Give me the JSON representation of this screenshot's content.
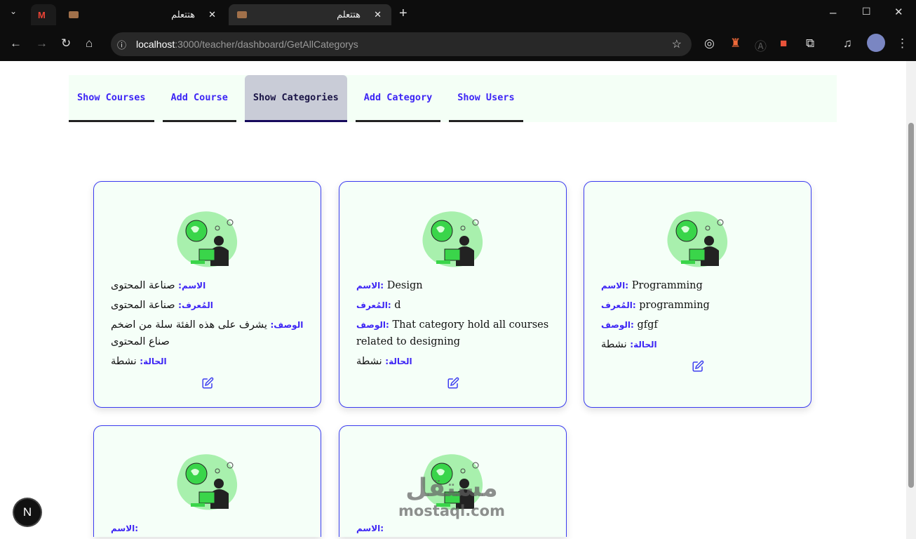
{
  "browser": {
    "tabs": [
      {
        "title": "هتتعلم"
      },
      {
        "title": "هتتعلم"
      }
    ],
    "url_host": "localhost",
    "url_path": ":3000/teacher/dashboard/GetAllCategorys"
  },
  "nav": {
    "tabs": [
      {
        "label": "Show Courses",
        "active": false
      },
      {
        "label": "Add Course",
        "active": false
      },
      {
        "label": "Show Categories",
        "active": true
      },
      {
        "label": "Add Category",
        "active": false
      },
      {
        "label": "Show Users",
        "active": false
      }
    ]
  },
  "labels": {
    "name": "الاسم",
    "slug": "المُعرف",
    "desc": "الوصف",
    "status": "الحالة"
  },
  "categories": [
    {
      "name": "صناعة المحتوى",
      "slug": "صناعة المحتوى",
      "desc": "يشرف على هذه الفئة سلة من اضخم صناع المحتوى",
      "status": "نشطة"
    },
    {
      "name": "Design",
      "slug": "d",
      "desc": "That category hold all courses related to designing",
      "status": "نشطة"
    },
    {
      "name": "Programming",
      "slug": "programming",
      "desc": "gfgf",
      "status": "نشطة"
    },
    {
      "name": "",
      "slug": "",
      "desc": "",
      "status": ""
    },
    {
      "name": "",
      "slug": "",
      "desc": "",
      "status": ""
    }
  ],
  "dev_badge": "N",
  "watermark": {
    "ar": "مستقل",
    "en": "mostaql.com"
  }
}
